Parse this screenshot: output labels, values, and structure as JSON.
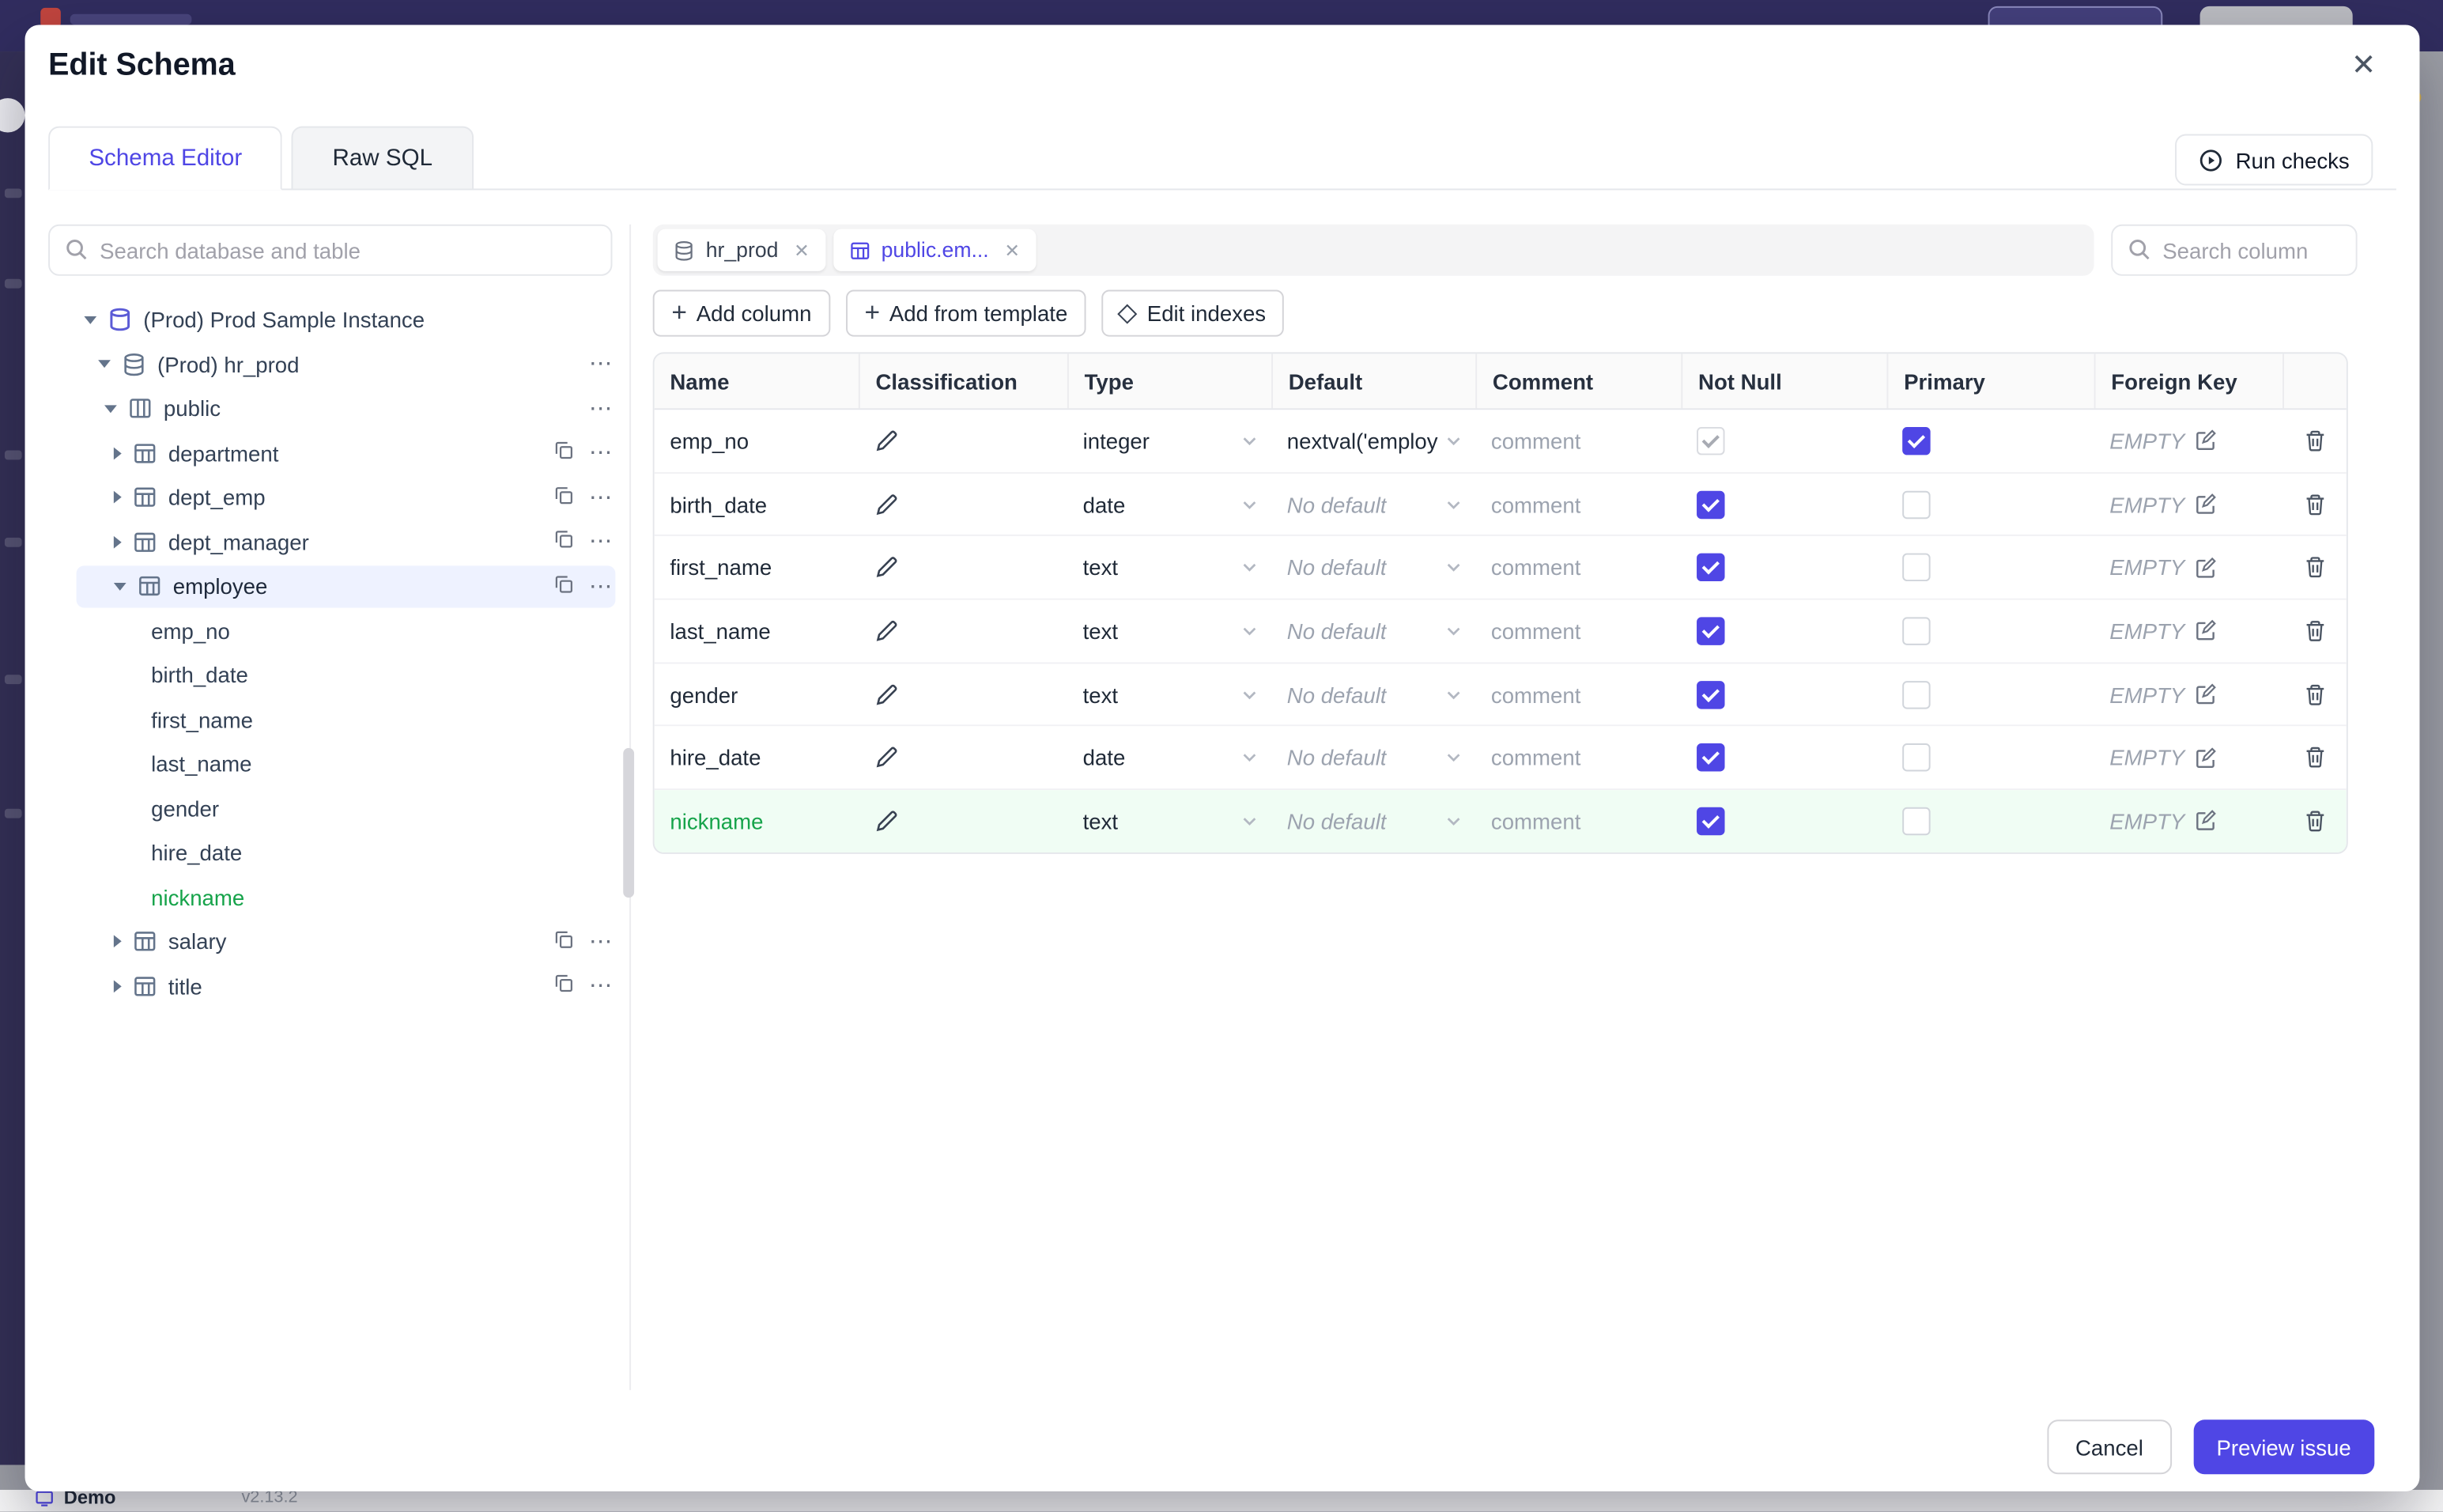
{
  "chrome": {
    "demo": "Demo",
    "version": "v2.13.2"
  },
  "modal": {
    "title": "Edit Schema",
    "close": "✕",
    "tabs": {
      "schema_editor": {
        "label": "Schema Editor",
        "cls": "active"
      },
      "raw_sql": {
        "label": "Raw SQL",
        "cls": ""
      }
    },
    "run_checks": "Run checks",
    "colors": {
      "accent": "#4f46e5",
      "new_green": "#16a34a"
    },
    "sidebar": {
      "search_placeholder": "Search database and table",
      "tree": {
        "items": [
          {
            "label": "(Prod) Prod Sample Instance",
            "caret": "down",
            "icon": "instance",
            "cls": "lvl0"
          },
          {
            "label": "(Prod) hr_prod",
            "caret": "down",
            "icon": "database",
            "cls": "lvl1"
          },
          {
            "label": "public",
            "caret": "down",
            "icon": "schema",
            "cls": "lvl2"
          },
          {
            "label": "department",
            "caret": "right",
            "icon": "table",
            "cls": "lvl3"
          },
          {
            "label": "dept_emp",
            "caret": "right",
            "icon": "table",
            "cls": "lvl3"
          },
          {
            "label": "dept_manager",
            "caret": "right",
            "icon": "table",
            "cls": "lvl3"
          },
          {
            "label": "employee",
            "caret": "down",
            "icon": "table",
            "cls": "lvl3 selected"
          },
          {
            "label": "emp_no",
            "cls": "lvl4"
          },
          {
            "label": "birth_date",
            "cls": "lvl4"
          },
          {
            "label": "first_name",
            "cls": "lvl4"
          },
          {
            "label": "last_name",
            "cls": "lvl4"
          },
          {
            "label": "gender",
            "cls": "lvl4"
          },
          {
            "label": "hire_date",
            "cls": "lvl4"
          },
          {
            "label": "nickname",
            "cls": "lvl4 new"
          },
          {
            "label": "salary",
            "caret": "right",
            "icon": "table",
            "cls": "lvl3"
          },
          {
            "label": "title",
            "caret": "right",
            "icon": "table",
            "cls": "lvl3"
          }
        ]
      }
    },
    "editor": {
      "chips": [
        {
          "label": "hr_prod",
          "cls": "",
          "icon": "database"
        },
        {
          "label": "public.em...",
          "cls": "active",
          "icon": "table"
        }
      ],
      "search_placeholder": "Search column",
      "toolbar": {
        "add_column": "Add column",
        "add_from_template": "Add from template",
        "edit_indexes": "Edit indexes"
      },
      "table": {
        "headers": {
          "name": "Name",
          "classification": "Classification",
          "type": "Type",
          "default": "Default",
          "comment": "Comment",
          "not_null": "Not Null",
          "primary": "Primary",
          "foreign_key": "Foreign Key"
        },
        "comment_placeholder": "comment",
        "fk_empty": "EMPTY",
        "rows": [
          {
            "name": "emp_no",
            "type": "integer",
            "default": "nextval('employ",
            "default_cls": "val",
            "not_null": "on-disabled",
            "primary": "on",
            "cls": ""
          },
          {
            "name": "birth_date",
            "type": "date",
            "default": "No default",
            "default_cls": "ph",
            "not_null": "on",
            "primary": "off",
            "cls": ""
          },
          {
            "name": "first_name",
            "type": "text",
            "default": "No default",
            "default_cls": "ph",
            "not_null": "on",
            "primary": "off",
            "cls": ""
          },
          {
            "name": "last_name",
            "type": "text",
            "default": "No default",
            "default_cls": "ph",
            "not_null": "on",
            "primary": "off",
            "cls": ""
          },
          {
            "name": "gender",
            "type": "text",
            "default": "No default",
            "default_cls": "ph",
            "not_null": "on",
            "primary": "off",
            "cls": ""
          },
          {
            "name": "hire_date",
            "type": "date",
            "default": "No default",
            "default_cls": "ph",
            "not_null": "on",
            "primary": "off",
            "cls": ""
          },
          {
            "name": "nickname",
            "type": "text",
            "default": "No default",
            "default_cls": "ph",
            "not_null": "on",
            "primary": "off",
            "cls": "new"
          }
        ]
      }
    },
    "footer": {
      "cancel": "Cancel",
      "preview": "Preview issue"
    }
  }
}
